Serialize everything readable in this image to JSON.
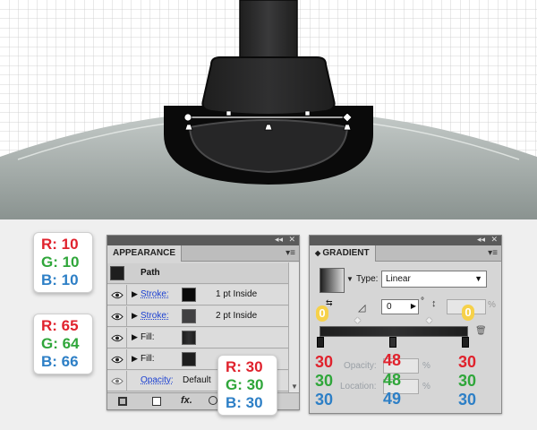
{
  "swatches": [
    {
      "r": "R: 10",
      "g": "G: 10",
      "b": "B: 10"
    },
    {
      "r": "R: 65",
      "g": "G: 64",
      "b": "B: 66"
    },
    {
      "r": "R: 30",
      "g": "G: 30",
      "b": "B: 30"
    }
  ],
  "appearance": {
    "tab": "APPEARANCE",
    "path_label": "Path",
    "rows": [
      {
        "label": "Stroke:",
        "desc": "1 pt  Inside",
        "color": "#0a0a0a"
      },
      {
        "label": "Stroke:",
        "desc": "2 pt  Inside",
        "color": "#414042"
      },
      {
        "label": "Fill:",
        "desc": "",
        "color": "gradient"
      },
      {
        "label": "Fill:",
        "desc": "",
        "color": "#1e1e1e"
      }
    ],
    "opacity_label": "Opacity:",
    "opacity_value": "Default",
    "fx_label": "fx."
  },
  "gradient": {
    "tab": "GRADIENT",
    "type_label": "Type:",
    "type_value": "Linear",
    "angle_value": "0",
    "degree_symbol": "°",
    "percent_symbol": "%",
    "badge_angle": "0",
    "badge_aspect": "0",
    "opacity_label": "Opacity:",
    "location_label": "Location:",
    "stops": [
      {
        "r": "30",
        "g": "30",
        "b": "30"
      },
      {
        "r": "48",
        "g": "48",
        "b": "49"
      },
      {
        "r": "30",
        "g": "30",
        "b": "30"
      }
    ]
  },
  "colors": {
    "red": "#e0222d",
    "green": "#2fa63a",
    "blue": "#2d7fc6",
    "badge": "#f6d14a"
  }
}
